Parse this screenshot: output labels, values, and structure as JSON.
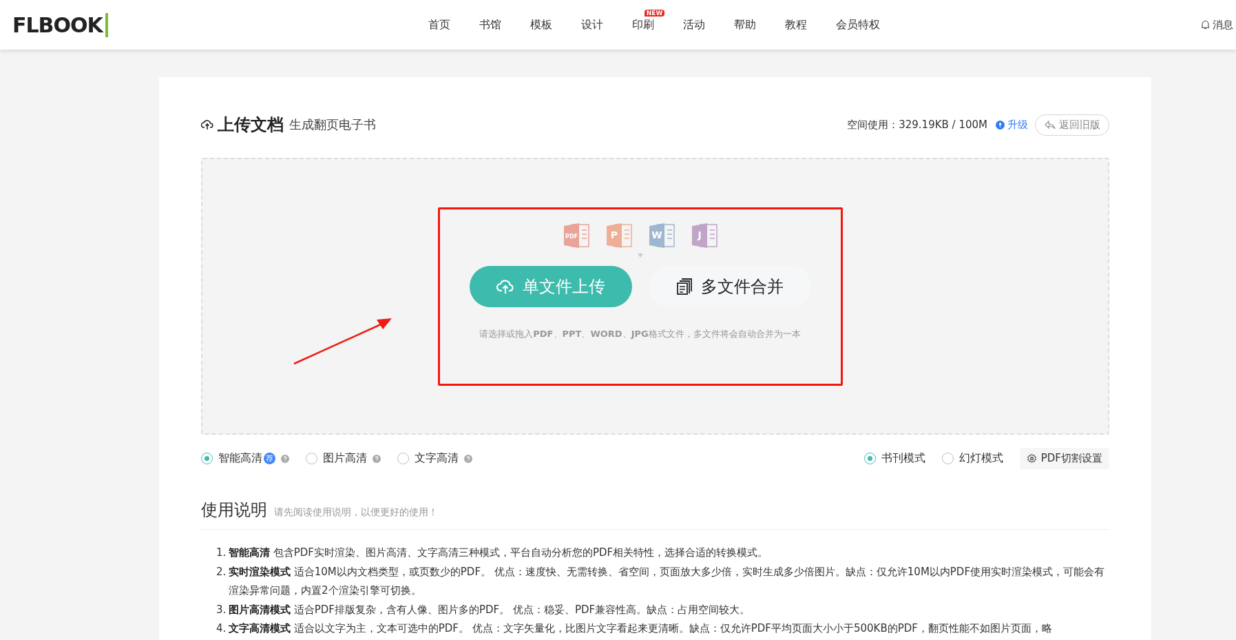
{
  "header": {
    "logo": "FLBOOK",
    "nav": [
      {
        "label": "首页",
        "selected": false
      },
      {
        "label": "书馆",
        "selected": false
      },
      {
        "label": "模板",
        "selected": false
      },
      {
        "label": "设计",
        "selected": false
      },
      {
        "label": "印刷",
        "selected": false,
        "badge": "NEW"
      },
      {
        "label": "活动",
        "selected": false
      },
      {
        "label": "帮助",
        "selected": false
      },
      {
        "label": "教程",
        "selected": false
      },
      {
        "label": "会员特权",
        "selected": false
      }
    ],
    "notifications": "消息"
  },
  "upload": {
    "title": "上传文档",
    "subtitle": "生成翻页电子书",
    "storage": "空间使用：329.19KB / 100M",
    "upgrade": "升级",
    "back": "返回旧版",
    "file_icons": [
      {
        "letter": "PDF",
        "color": "#e9a398"
      },
      {
        "letter": "P",
        "color": "#efae96"
      },
      {
        "letter": "W",
        "color": "#9fb6d0"
      },
      {
        "letter": "J",
        "color": "#c0a5c8"
      }
    ],
    "buttons": [
      {
        "label": "单文件上传",
        "kind": "primary"
      },
      {
        "label": "多文件合并",
        "kind": "secondary"
      }
    ],
    "hint": "请选择或拖入**PDF**、**PPT**、**WORD**、**JPG**格式文件，多文件将会自动合并为一本"
  },
  "quality_options": [
    {
      "label": "智能高清",
      "selected": true,
      "badge": "荐"
    },
    {
      "label": "图片高清",
      "selected": false
    },
    {
      "label": "文字高清",
      "selected": false
    }
  ],
  "view_modes": [
    {
      "label": "书刊模式",
      "selected": true
    },
    {
      "label": "幻灯模式",
      "selected": false
    }
  ],
  "settings_button": "PDF切割设置",
  "instructions": {
    "title": "使用说明",
    "subtitle": "请先阅读使用说明，以便更好的使用！",
    "items": [
      {
        "number": "1.",
        "text": "**智能高清** 包含PDF实时渲染、图片高清、文字高清三种模式，平台自动分析您的PDF相关特性，选择合适的转换模式。"
      },
      {
        "number": "2.",
        "text": "**实时渲染模式** 适合10M以内文档类型，或页数少的PDF。 优点：速度快、无需转换、省空间，页面放大多少倍，实时生成多少倍图片。缺点：仅允许10M以内PDF使用实时渲染模式，可能会有渲染异常问题，内置2个渲染引擎可切换。"
      },
      {
        "number": "3.",
        "text": "**图片高清模式** 适合PDF排版复杂，含有人像、图片多的PDF。 优点：稳妥、PDF兼容性高。缺点：占用空间较大。"
      },
      {
        "number": "4.",
        "text": "**文字高清模式** 适合以文字为主，文本可选中的PDF。 优点：文字矢量化，比图片文字看起来更清晰。缺点：仅允许PDF平均页面大小小于500KB的PDF，翻页性能不如图片页面，略"
      }
    ]
  }
}
